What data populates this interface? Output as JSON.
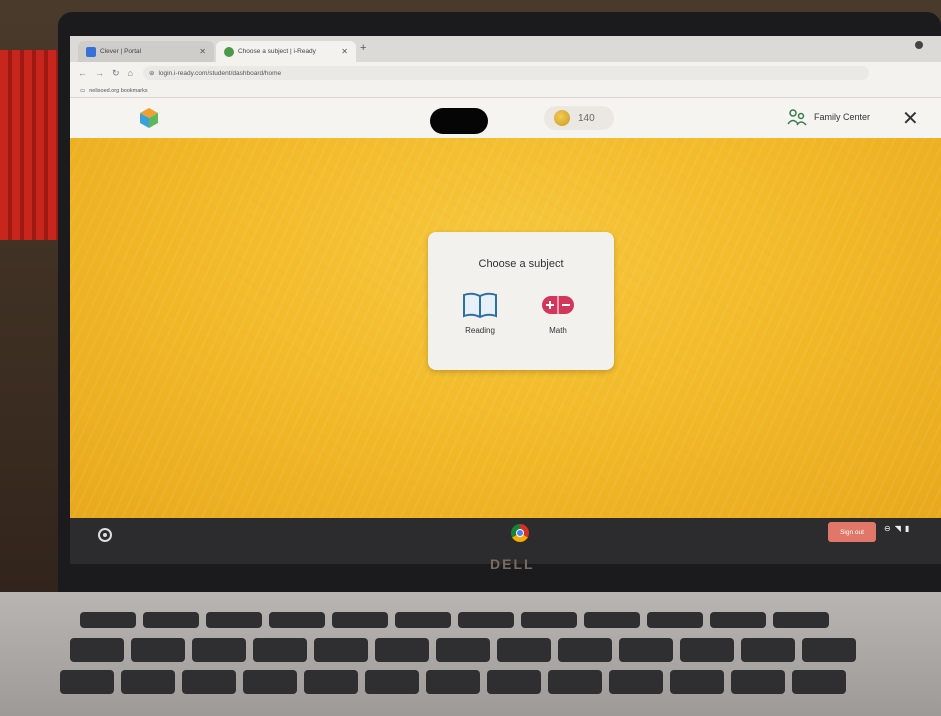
{
  "browser": {
    "tabs": [
      {
        "title": "Clever | Portal",
        "active": false
      },
      {
        "title": "Choose a subject | i-Ready",
        "active": true
      }
    ],
    "url": "login.i-ready.com/student/dashboard/home",
    "bookmark": "nelisoed.org bookmarks"
  },
  "header": {
    "coins": "140",
    "family_center_label": "Family Center"
  },
  "subject_card": {
    "title": "Choose a subject",
    "subjects": [
      {
        "label": "Reading"
      },
      {
        "label": "Math"
      }
    ]
  },
  "shelf": {
    "sign_out_label": "Sign out"
  },
  "device": {
    "brand": "DELL"
  },
  "colors": {
    "background_yellow": "#f1b826",
    "card_bg": "#f3f1ee",
    "reading_icon": "#2d6fa3",
    "math_icon": "#d2365a",
    "signout_bg": "#e07768"
  }
}
